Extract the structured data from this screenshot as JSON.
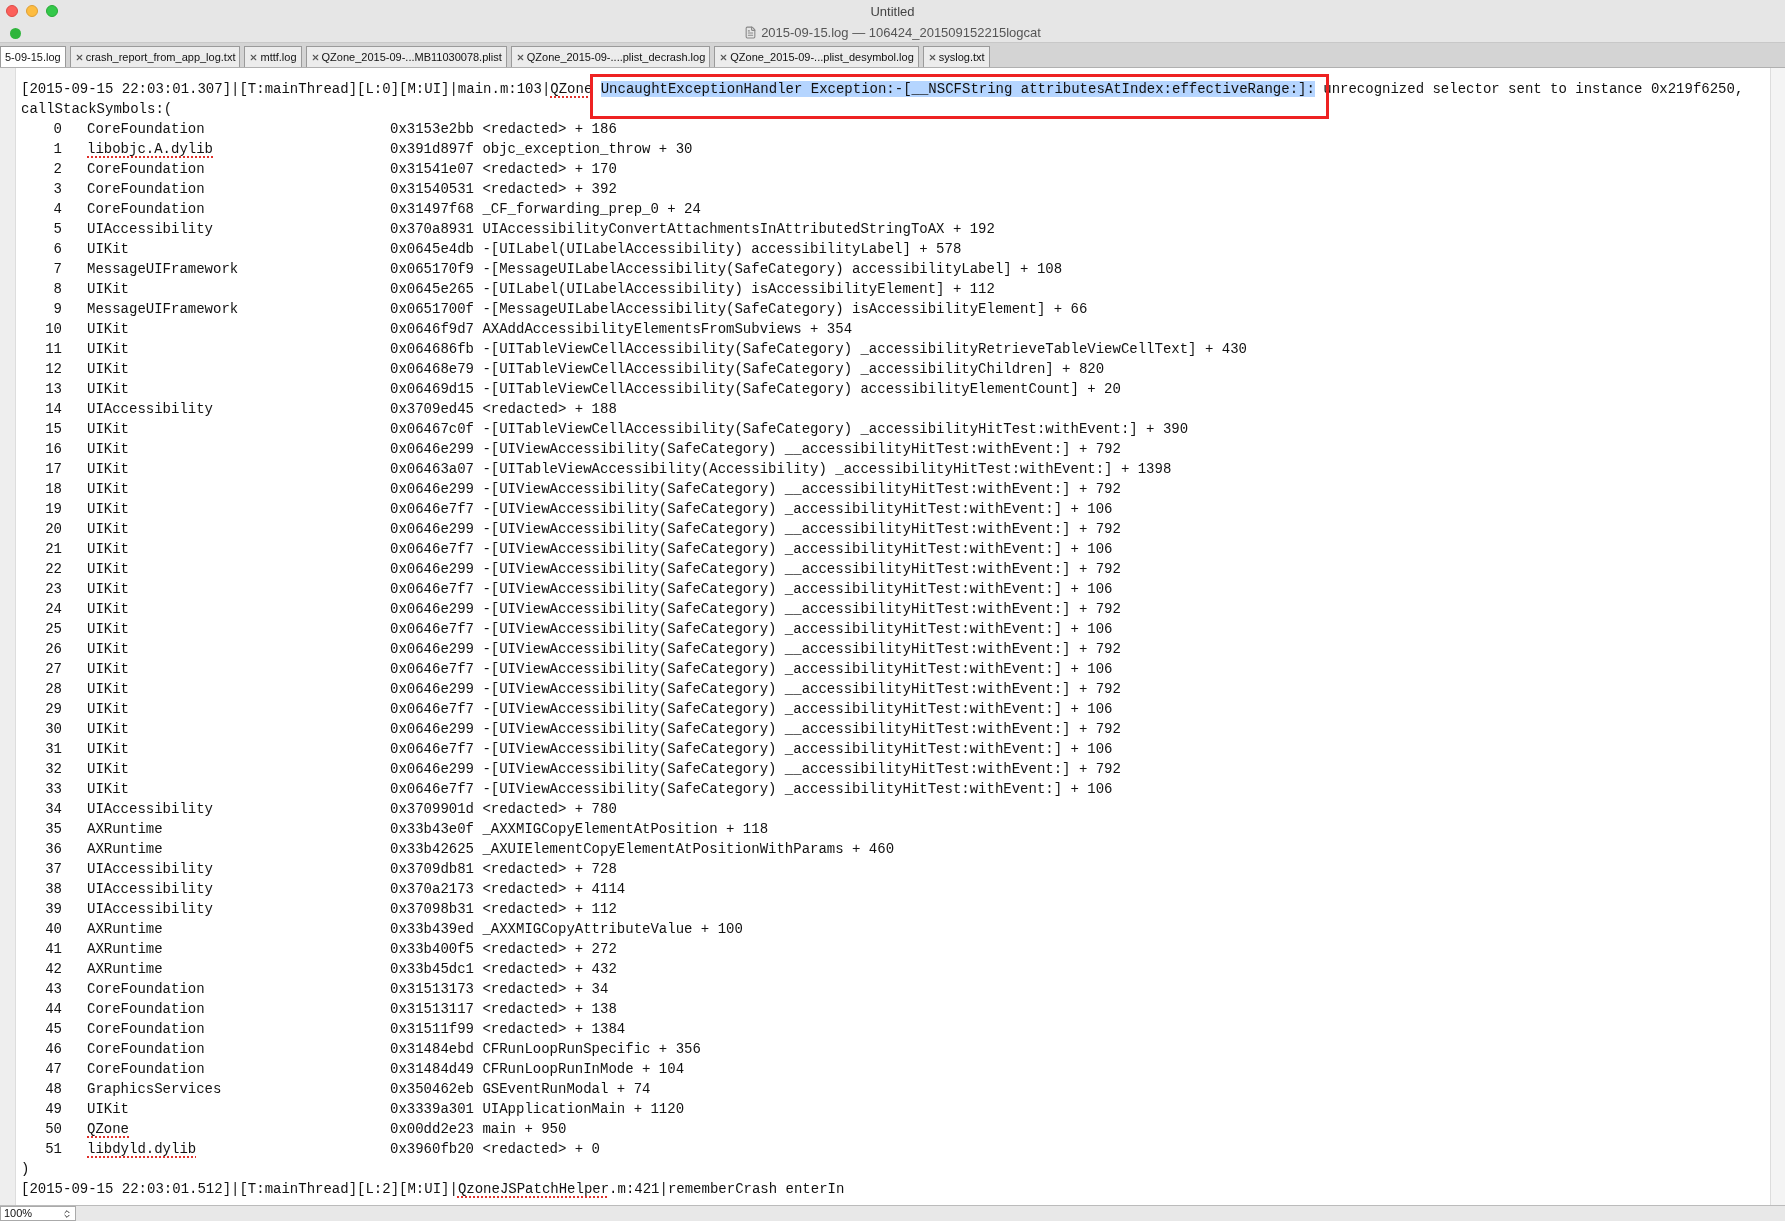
{
  "window": {
    "title": "Untitled",
    "document_title": "2015-09-15.log — 106424_201509152215logcat"
  },
  "tabs": [
    {
      "label": "5-09-15.log",
      "selected": true
    },
    {
      "label": "crash_report_from_app_log.txt",
      "selected": false
    },
    {
      "label": "mttf.log",
      "selected": false
    },
    {
      "label": "QZone_2015-09-...MB11030078.plist",
      "selected": false
    },
    {
      "label": "QZone_2015-09-....plist_decrash.log",
      "selected": false
    },
    {
      "label": "QZone_2015-09-...plist_desymbol.log",
      "selected": false
    },
    {
      "label": "syslog.txt",
      "selected": false
    }
  ],
  "log": {
    "header": [
      {
        "text": "[2015-09-15 22:03:01.307]|[T:mainThread][L:0][M:UI]|main.m:103|",
        "kind": "plain"
      },
      {
        "text": "QZone",
        "kind": "misspelled"
      },
      {
        "text": "UncaughtExceptionHandler Exception:-[__NSCFString attributesAtIndex:effectiveRange:]:",
        "kind": "selected"
      },
      {
        "text": "unrecognized selector sent to instance 0x219f6250,",
        "kind": "plain"
      }
    ],
    "stack_title": "callStackSymbols:(",
    "frames": [
      {
        "index": "0",
        "image": "CoreFoundation",
        "address": "0x3153e2bb",
        "symbol": "<redacted> + 186",
        "misspelled": false
      },
      {
        "index": "1",
        "image": "libobjc.A.dylib",
        "address": "0x391d897f",
        "symbol": "objc_exception_throw + 30",
        "misspelled": true
      },
      {
        "index": "2",
        "image": "CoreFoundation",
        "address": "0x31541e07",
        "symbol": "<redacted> + 170",
        "misspelled": false
      },
      {
        "index": "3",
        "image": "CoreFoundation",
        "address": "0x31540531",
        "symbol": "<redacted> + 392",
        "misspelled": false
      },
      {
        "index": "4",
        "image": "CoreFoundation",
        "address": "0x31497f68",
        "symbol": "_CF_forwarding_prep_0 + 24",
        "misspelled": false
      },
      {
        "index": "5",
        "image": "UIAccessibility",
        "address": "0x370a8931",
        "symbol": "UIAccessibilityConvertAttachmentsInAttributedStringToAX + 192",
        "misspelled": false
      },
      {
        "index": "6",
        "image": "UIKit",
        "address": "0x0645e4db",
        "symbol": "-[UILabel(UILabelAccessibility) accessibilityLabel] + 578",
        "misspelled": false
      },
      {
        "index": "7",
        "image": "MessageUIFramework",
        "address": "0x065170f9",
        "symbol": "-[MessageUILabelAccessibility(SafeCategory) accessibilityLabel] + 108",
        "misspelled": false
      },
      {
        "index": "8",
        "image": "UIKit",
        "address": "0x0645e265",
        "symbol": "-[UILabel(UILabelAccessibility) isAccessibilityElement] + 112",
        "misspelled": false
      },
      {
        "index": "9",
        "image": "MessageUIFramework",
        "address": "0x0651700f",
        "symbol": "-[MessageUILabelAccessibility(SafeCategory) isAccessibilityElement] + 66",
        "misspelled": false
      },
      {
        "index": "10",
        "image": "UIKit",
        "address": "0x0646f9d7",
        "symbol": "AXAddAccessibilityElementsFromSubviews + 354",
        "misspelled": false
      },
      {
        "index": "11",
        "image": "UIKit",
        "address": "0x064686fb",
        "symbol": "-[UITableViewCellAccessibility(SafeCategory) _accessibilityRetrieveTableViewCellText] + 430",
        "misspelled": false
      },
      {
        "index": "12",
        "image": "UIKit",
        "address": "0x06468e79",
        "symbol": "-[UITableViewCellAccessibility(SafeCategory) _accessibilityChildren] + 820",
        "misspelled": false
      },
      {
        "index": "13",
        "image": "UIKit",
        "address": "0x06469d15",
        "symbol": "-[UITableViewCellAccessibility(SafeCategory) accessibilityElementCount] + 20",
        "misspelled": false
      },
      {
        "index": "14",
        "image": "UIAccessibility",
        "address": "0x3709ed45",
        "symbol": "<redacted> + 188",
        "misspelled": false
      },
      {
        "index": "15",
        "image": "UIKit",
        "address": "0x06467c0f",
        "symbol": "-[UITableViewCellAccessibility(SafeCategory) _accessibilityHitTest:withEvent:] + 390",
        "misspelled": false
      },
      {
        "index": "16",
        "image": "UIKit",
        "address": "0x0646e299",
        "symbol": "-[UIViewAccessibility(SafeCategory) __accessibilityHitTest:withEvent:] + 792",
        "misspelled": false
      },
      {
        "index": "17",
        "image": "UIKit",
        "address": "0x06463a07",
        "symbol": "-[UITableViewAccessibility(Accessibility) _accessibilityHitTest:withEvent:] + 1398",
        "misspelled": false
      },
      {
        "index": "18",
        "image": "UIKit",
        "address": "0x0646e299",
        "symbol": "-[UIViewAccessibility(SafeCategory) __accessibilityHitTest:withEvent:] + 792",
        "misspelled": false
      },
      {
        "index": "19",
        "image": "UIKit",
        "address": "0x0646e7f7",
        "symbol": "-[UIViewAccessibility(SafeCategory) _accessibilityHitTest:withEvent:] + 106",
        "misspelled": false
      },
      {
        "index": "20",
        "image": "UIKit",
        "address": "0x0646e299",
        "symbol": "-[UIViewAccessibility(SafeCategory) __accessibilityHitTest:withEvent:] + 792",
        "misspelled": false
      },
      {
        "index": "21",
        "image": "UIKit",
        "address": "0x0646e7f7",
        "symbol": "-[UIViewAccessibility(SafeCategory) _accessibilityHitTest:withEvent:] + 106",
        "misspelled": false
      },
      {
        "index": "22",
        "image": "UIKit",
        "address": "0x0646e299",
        "symbol": "-[UIViewAccessibility(SafeCategory) __accessibilityHitTest:withEvent:] + 792",
        "misspelled": false
      },
      {
        "index": "23",
        "image": "UIKit",
        "address": "0x0646e7f7",
        "symbol": "-[UIViewAccessibility(SafeCategory) _accessibilityHitTest:withEvent:] + 106",
        "misspelled": false
      },
      {
        "index": "24",
        "image": "UIKit",
        "address": "0x0646e299",
        "symbol": "-[UIViewAccessibility(SafeCategory) __accessibilityHitTest:withEvent:] + 792",
        "misspelled": false
      },
      {
        "index": "25",
        "image": "UIKit",
        "address": "0x0646e7f7",
        "symbol": "-[UIViewAccessibility(SafeCategory) _accessibilityHitTest:withEvent:] + 106",
        "misspelled": false
      },
      {
        "index": "26",
        "image": "UIKit",
        "address": "0x0646e299",
        "symbol": "-[UIViewAccessibility(SafeCategory) __accessibilityHitTest:withEvent:] + 792",
        "misspelled": false
      },
      {
        "index": "27",
        "image": "UIKit",
        "address": "0x0646e7f7",
        "symbol": "-[UIViewAccessibility(SafeCategory) _accessibilityHitTest:withEvent:] + 106",
        "misspelled": false
      },
      {
        "index": "28",
        "image": "UIKit",
        "address": "0x0646e299",
        "symbol": "-[UIViewAccessibility(SafeCategory) __accessibilityHitTest:withEvent:] + 792",
        "misspelled": false
      },
      {
        "index": "29",
        "image": "UIKit",
        "address": "0x0646e7f7",
        "symbol": "-[UIViewAccessibility(SafeCategory) _accessibilityHitTest:withEvent:] + 106",
        "misspelled": false
      },
      {
        "index": "30",
        "image": "UIKit",
        "address": "0x0646e299",
        "symbol": "-[UIViewAccessibility(SafeCategory) __accessibilityHitTest:withEvent:] + 792",
        "misspelled": false
      },
      {
        "index": "31",
        "image": "UIKit",
        "address": "0x0646e7f7",
        "symbol": "-[UIViewAccessibility(SafeCategory) _accessibilityHitTest:withEvent:] + 106",
        "misspelled": false
      },
      {
        "index": "32",
        "image": "UIKit",
        "address": "0x0646e299",
        "symbol": "-[UIViewAccessibility(SafeCategory) __accessibilityHitTest:withEvent:] + 792",
        "misspelled": false
      },
      {
        "index": "33",
        "image": "UIKit",
        "address": "0x0646e7f7",
        "symbol": "-[UIViewAccessibility(SafeCategory) _accessibilityHitTest:withEvent:] + 106",
        "misspelled": false
      },
      {
        "index": "34",
        "image": "UIAccessibility",
        "address": "0x3709901d",
        "symbol": "<redacted> + 780",
        "misspelled": false
      },
      {
        "index": "35",
        "image": "AXRuntime",
        "address": "0x33b43e0f",
        "symbol": "_AXXMIGCopyElementAtPosition + 118",
        "misspelled": false
      },
      {
        "index": "36",
        "image": "AXRuntime",
        "address": "0x33b42625",
        "symbol": "_AXUIElementCopyElementAtPositionWithParams + 460",
        "misspelled": false
      },
      {
        "index": "37",
        "image": "UIAccessibility",
        "address": "0x3709db81",
        "symbol": "<redacted> + 728",
        "misspelled": false
      },
      {
        "index": "38",
        "image": "UIAccessibility",
        "address": "0x370a2173",
        "symbol": "<redacted> + 4114",
        "misspelled": false
      },
      {
        "index": "39",
        "image": "UIAccessibility",
        "address": "0x37098b31",
        "symbol": "<redacted> + 112",
        "misspelled": false
      },
      {
        "index": "40",
        "image": "AXRuntime",
        "address": "0x33b439ed",
        "symbol": "_AXXMIGCopyAttributeValue + 100",
        "misspelled": false
      },
      {
        "index": "41",
        "image": "AXRuntime",
        "address": "0x33b400f5",
        "symbol": "<redacted> + 272",
        "misspelled": false
      },
      {
        "index": "42",
        "image": "AXRuntime",
        "address": "0x33b45dc1",
        "symbol": "<redacted> + 432",
        "misspelled": false
      },
      {
        "index": "43",
        "image": "CoreFoundation",
        "address": "0x31513173",
        "symbol": "<redacted> + 34",
        "misspelled": false
      },
      {
        "index": "44",
        "image": "CoreFoundation",
        "address": "0x31513117",
        "symbol": "<redacted> + 138",
        "misspelled": false
      },
      {
        "index": "45",
        "image": "CoreFoundation",
        "address": "0x31511f99",
        "symbol": "<redacted> + 1384",
        "misspelled": false
      },
      {
        "index": "46",
        "image": "CoreFoundation",
        "address": "0x31484ebd",
        "symbol": "CFRunLoopRunSpecific + 356",
        "misspelled": false
      },
      {
        "index": "47",
        "image": "CoreFoundation",
        "address": "0x31484d49",
        "symbol": "CFRunLoopRunInMode + 104",
        "misspelled": false
      },
      {
        "index": "48",
        "image": "GraphicsServices",
        "address": "0x350462eb",
        "symbol": "GSEventRunModal + 74",
        "misspelled": false
      },
      {
        "index": "49",
        "image": "UIKit",
        "address": "0x3339a301",
        "symbol": "UIApplicationMain + 1120",
        "misspelled": false
      },
      {
        "index": "50",
        "image": "QZone",
        "address": "0x00dd2e23",
        "symbol": "main + 950",
        "misspelled": true
      },
      {
        "index": "51",
        "image": "libdyld.dylib",
        "address": "0x3960fb20",
        "symbol": "<redacted> + 0",
        "misspelled": true
      }
    ],
    "stack_end": ")",
    "footer": [
      {
        "text": "[2015-09-15 22:03:01.512]|[T:mainThread][L:2][M:UI]|",
        "misspelled": false
      },
      {
        "text": "QzoneJSPatchHelper",
        "misspelled": true
      },
      {
        "text": ".m:421|rememberCrash enterIn",
        "misspelled": false
      }
    ]
  },
  "status_bar": {
    "zoom": "100%"
  }
}
